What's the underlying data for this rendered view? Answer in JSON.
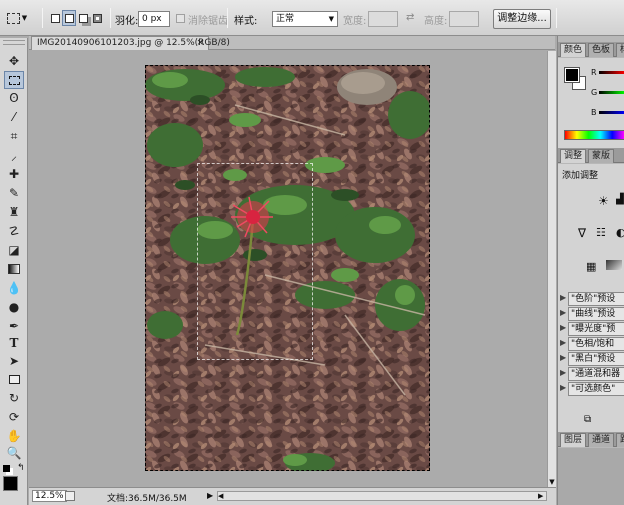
{
  "options_bar": {
    "feather_label": "羽化:",
    "feather_value": "0 px",
    "antialias_label": "消除锯齿",
    "style_label": "样式:",
    "style_value": "正常",
    "width_label": "宽度:",
    "height_label": "高度:",
    "refine_edge_button": "调整边缘..."
  },
  "document": {
    "tab_title": "IMG20140906101203.jpg @ 12.5%(RGB/8)",
    "tab_close": "×",
    "zoom": "12.5%",
    "doc_size": "文档:36.5M/36.5M"
  },
  "panels": {
    "color_tabs": [
      "颜色",
      "色板",
      "样"
    ],
    "channel_labels": [
      "R",
      "G",
      "B"
    ],
    "adjust_tabs": [
      "调整",
      "蒙版"
    ],
    "adjust_title": "添加调整",
    "presets": [
      "\"色阶\"预设",
      "\"曲线\"预设",
      "\"曝光度\"预",
      "\"色相/饱和",
      "\"黑白\"预设",
      "\"通道混和器",
      "\"可选颜色\""
    ],
    "layers_tabs": [
      "图层",
      "通道",
      "路"
    ]
  },
  "colors": {
    "foreground": "#000000",
    "background": "#ffffff",
    "flower": "#e8334e"
  }
}
